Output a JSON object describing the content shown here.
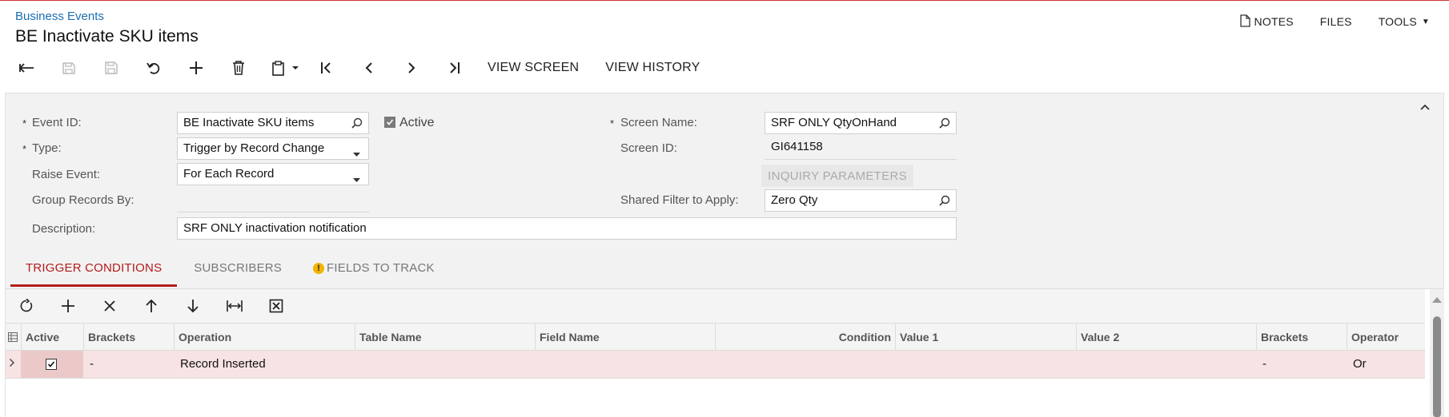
{
  "header": {
    "breadcrumb": "Business Events",
    "title": "BE Inactivate SKU items",
    "notes_label": "NOTES",
    "files_label": "FILES",
    "tools_label": "TOOLS"
  },
  "toolbar": {
    "icons": [
      "back-icon",
      "save-close-icon",
      "save-icon",
      "undo-icon",
      "add-icon",
      "delete-icon",
      "clipboard-icon",
      "first-record-icon",
      "previous-record-icon",
      "next-record-icon",
      "last-record-icon"
    ],
    "view_screen_label": "VIEW SCREEN",
    "view_history_label": "VIEW HISTORY"
  },
  "form": {
    "event_id": {
      "label": "Event ID:",
      "value": "BE Inactivate SKU items",
      "required": "*"
    },
    "type": {
      "label": "Type:",
      "value": "Trigger by Record Change",
      "required": "*"
    },
    "raise_event": {
      "label": "Raise Event:",
      "value": "For Each Record"
    },
    "group_records_by": {
      "label": "Group Records By:",
      "value": ""
    },
    "description": {
      "label": "Description:",
      "value": "SRF ONLY inactivation notification"
    },
    "active": {
      "label": "Active",
      "checked": true
    },
    "screen_name": {
      "label": "Screen Name:",
      "value": "SRF ONLY QtyOnHand",
      "required": "*"
    },
    "screen_id": {
      "label": "Screen ID:",
      "value": "GI641158"
    },
    "inquiry_parameters_label": "INQUIRY PARAMETERS",
    "shared_filter": {
      "label": "Shared Filter to Apply:",
      "value": "Zero Qty"
    }
  },
  "tabs": [
    {
      "label": "TRIGGER CONDITIONS",
      "active": true
    },
    {
      "label": "SUBSCRIBERS",
      "active": false
    },
    {
      "label": "FIELDS TO TRACK",
      "active": false,
      "warning": "!"
    }
  ],
  "grid": {
    "toolbar_icons": [
      "refresh-icon",
      "add-row-icon",
      "delete-row-icon",
      "move-up-icon",
      "move-down-icon",
      "fit-columns-icon",
      "export-excel-icon"
    ],
    "columns": [
      "Active",
      "Brackets",
      "Operation",
      "Table Name",
      "Field Name",
      "Condition",
      "Value 1",
      "Value 2",
      "Brackets",
      "Operator"
    ],
    "rows": [
      {
        "active": true,
        "brackets_open": "-",
        "operation": "Record Inserted",
        "table_name": "",
        "field_name": "",
        "condition": "",
        "value1": "",
        "value2": "",
        "brackets_close": "-",
        "operator": "Or"
      }
    ]
  },
  "colors": {
    "accent": "#b41b1b",
    "link": "#1a6fb5",
    "row_highlight": "#f7e3e3"
  }
}
